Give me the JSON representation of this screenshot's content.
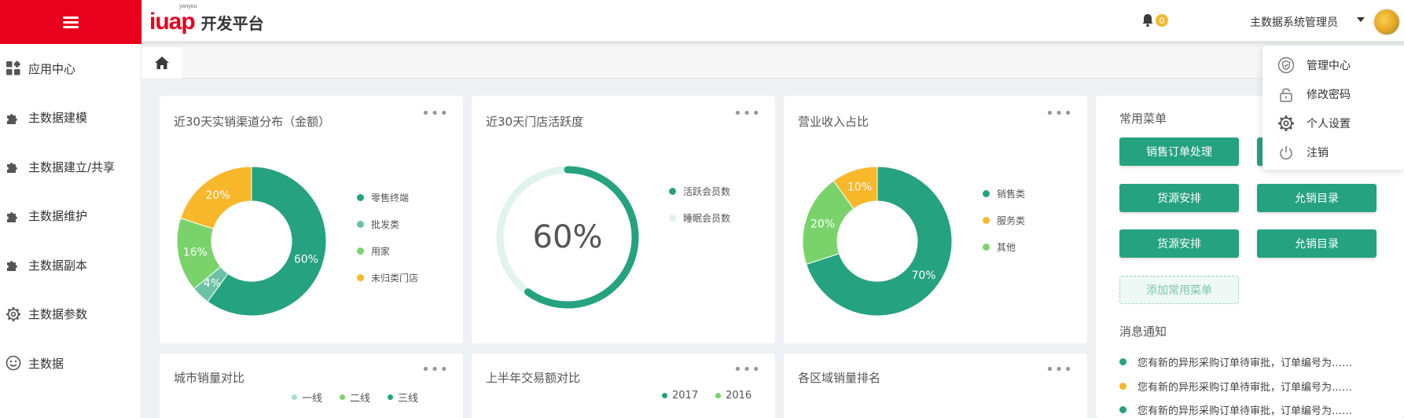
{
  "header": {
    "logo_brand": "iuap",
    "logo_small": "yonyou",
    "logo_text": "开发平台",
    "notification_count": "0",
    "user_name": "主数据系统管理员"
  },
  "sidebar": {
    "items": [
      {
        "label": "应用中心",
        "icon": "apps-icon"
      },
      {
        "label": "主数据建模",
        "icon": "puzzle-icon"
      },
      {
        "label": "主数据建立/共享",
        "icon": "puzzle-icon"
      },
      {
        "label": "主数据维护",
        "icon": "puzzle-icon"
      },
      {
        "label": "主数据副本",
        "icon": "puzzle-icon"
      },
      {
        "label": "主数据参数",
        "icon": "gear-icon"
      },
      {
        "label": "主数据",
        "icon": "smile-icon"
      }
    ]
  },
  "user_menu": {
    "items": [
      {
        "label": "管理中心",
        "icon": "shield-icon"
      },
      {
        "label": "修改密码",
        "icon": "lock-icon"
      },
      {
        "label": "个人设置",
        "icon": "gear-icon"
      },
      {
        "label": "注销",
        "icon": "power-icon"
      }
    ]
  },
  "colors": {
    "brand_red": "#e8001c",
    "green": "#25a27f",
    "teal": "#6cc2a5",
    "light_green": "#7ad36a",
    "yellow": "#f9b72a",
    "pale": "#e0f3ee"
  },
  "cards": {
    "channel": {
      "title": "近30天实销渠道分布（金额）",
      "more": "•••",
      "chart_data": {
        "type": "pie",
        "categories": [
          "零售终端",
          "批发类",
          "用家",
          "未归类门店"
        ],
        "values": [
          60,
          4,
          16,
          20
        ],
        "labels": [
          "60%",
          "4%",
          "16%",
          "20%"
        ]
      }
    },
    "activity": {
      "title": "近30天门店活跃度",
      "more": "•••",
      "center_label": "60%",
      "chart_data": {
        "type": "pie",
        "categories": [
          "活跃会员数",
          "睡眠会员数"
        ],
        "values": [
          60,
          40
        ]
      }
    },
    "revenue": {
      "title": "营业收入占比",
      "more": "•••",
      "chart_data": {
        "type": "pie",
        "categories": [
          "销售类",
          "服务类",
          "其他"
        ],
        "values": [
          70,
          10,
          20
        ],
        "labels": [
          "70%",
          "10%",
          "20%"
        ]
      }
    },
    "city": {
      "title": "城市销量对比",
      "more": "•••",
      "legend": [
        "一线",
        "二线",
        "三线"
      ]
    },
    "trade": {
      "title": "上半年交易额对比",
      "more": "•••",
      "legend": [
        "2017",
        "2016"
      ]
    },
    "region": {
      "title": "各区域销量排名",
      "more": "•••"
    }
  },
  "common_menu": {
    "title": "常用菜单",
    "buttons": [
      "销售订单处理",
      "",
      "货源安排",
      "允销目录",
      "货源安排",
      "允销目录"
    ],
    "add_label": "添加常用菜单"
  },
  "notices": {
    "title": "消息通知",
    "items": [
      {
        "text": "您有新的异形采购订单待审批，订单编号为……",
        "color": "#25a27f"
      },
      {
        "text": "您有新的异形采购订单待审批，订单编号为……",
        "color": "#f9b72a"
      },
      {
        "text": "您有新的异形采购订单待审批，订单编号为……",
        "color": "#25a27f"
      }
    ]
  }
}
